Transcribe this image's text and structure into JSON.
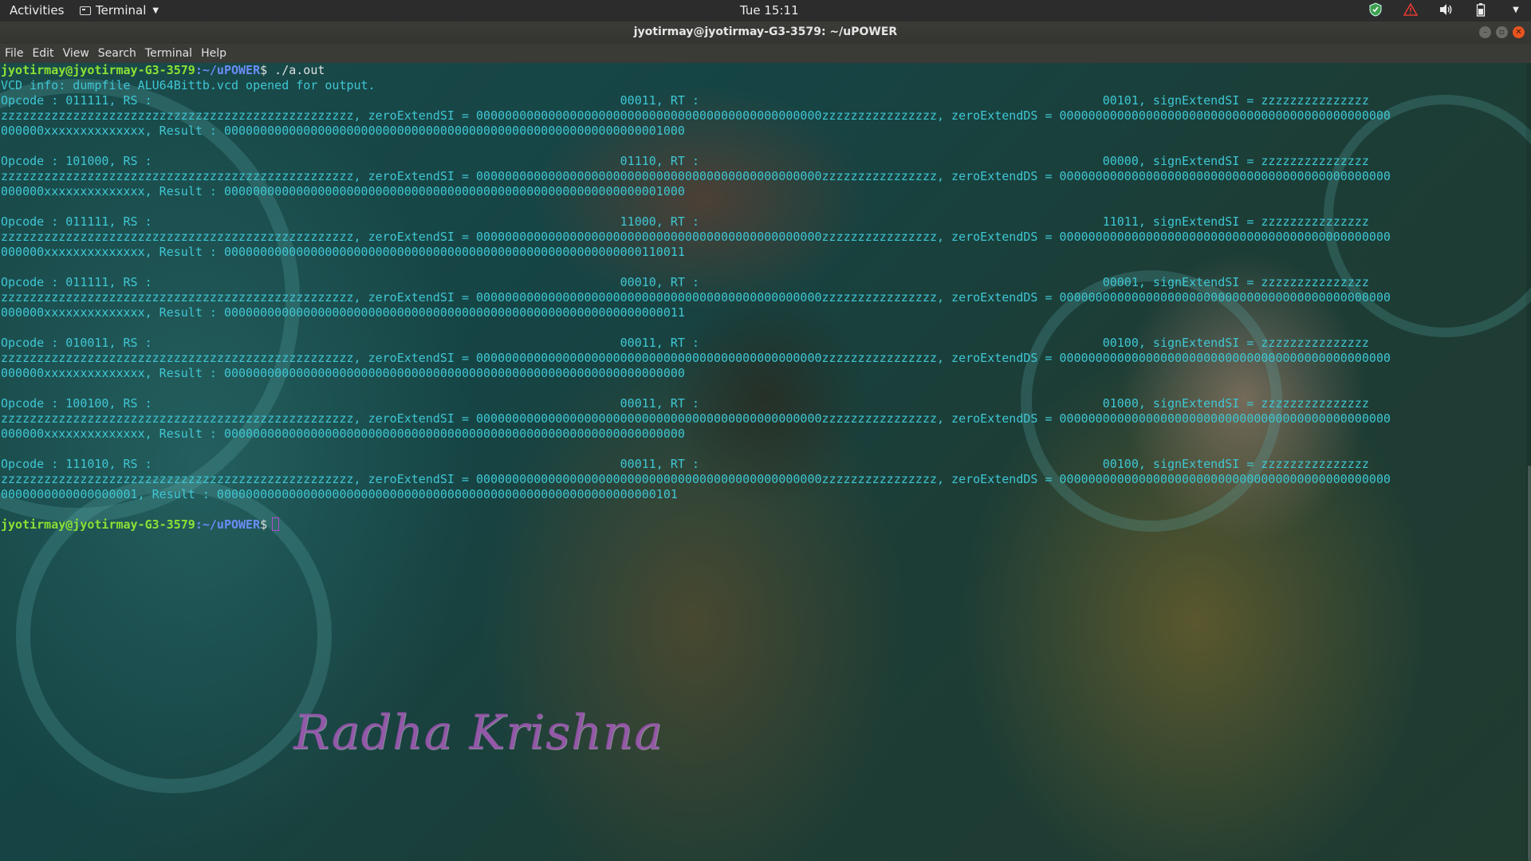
{
  "topbar": {
    "activities": "Activities",
    "app_name": "Terminal",
    "clock": "Tue 15:11",
    "tray_icons": [
      "shield-icon",
      "warning-icon",
      "volume-icon",
      "battery-icon",
      "chevron-down-icon"
    ]
  },
  "window": {
    "title": "jyotirmay@jyotirmay-G3-3579: ~/uPOWER"
  },
  "menu": {
    "items": [
      "File",
      "Edit",
      "View",
      "Search",
      "Terminal",
      "Help"
    ]
  },
  "terminal": {
    "prompt_user": "jyotirmay@jyotirmay-G3-3579",
    "prompt_path": ":~/uPOWER",
    "prompt_dollar": "$",
    "command": " ./a.out",
    "lines": [
      "VCD info: dumpfile ALU64Bittb.vcd opened for output.",
      "Opcode : 011111, RS :                                                                 00011, RT :                                                        00101, signExtendSI = zzzzzzzzzzzzzzz",
      "zzzzzzzzzzzzzzzzzzzzzzzzzzzzzzzzzzzzzzzzzzzzzzzzz, zeroExtendSI = 000000000000000000000000000000000000000000000000zzzzzzzzzzzzzzzz, zeroExtendDS = 0000000000000000000000000000000000000000000000",
      "000000xxxxxxxxxxxxxx, Result : 0000000000000000000000000000000000000000000000000000000000001000",
      "",
      "Opcode : 101000, RS :                                                                 01110, RT :                                                        00000, signExtendSI = zzzzzzzzzzzzzzz",
      "zzzzzzzzzzzzzzzzzzzzzzzzzzzzzzzzzzzzzzzzzzzzzzzzz, zeroExtendSI = 000000000000000000000000000000000000000000000000zzzzzzzzzzzzzzzz, zeroExtendDS = 0000000000000000000000000000000000000000000000",
      "000000xxxxxxxxxxxxxx, Result : 0000000000000000000000000000000000000000000000000000000000001000",
      "",
      "Opcode : 011111, RS :                                                                 11000, RT :                                                        11011, signExtendSI = zzzzzzzzzzzzzzz",
      "zzzzzzzzzzzzzzzzzzzzzzzzzzzzzzzzzzzzzzzzzzzzzzzzz, zeroExtendSI = 000000000000000000000000000000000000000000000000zzzzzzzzzzzzzzzz, zeroExtendDS = 0000000000000000000000000000000000000000000000",
      "000000xxxxxxxxxxxxxx, Result : 0000000000000000000000000000000000000000000000000000000000110011",
      "",
      "Opcode : 011111, RS :                                                                 00010, RT :                                                        00001, signExtendSI = zzzzzzzzzzzzzzz",
      "zzzzzzzzzzzzzzzzzzzzzzzzzzzzzzzzzzzzzzzzzzzzzzzzz, zeroExtendSI = 000000000000000000000000000000000000000000000000zzzzzzzzzzzzzzzz, zeroExtendDS = 0000000000000000000000000000000000000000000000",
      "000000xxxxxxxxxxxxxx, Result : 0000000000000000000000000000000000000000000000000000000000000011",
      "",
      "Opcode : 010011, RS :                                                                 00011, RT :                                                        00100, signExtendSI = zzzzzzzzzzzzzzz",
      "zzzzzzzzzzzzzzzzzzzzzzzzzzzzzzzzzzzzzzzzzzzzzzzzz, zeroExtendSI = 000000000000000000000000000000000000000000000000zzzzzzzzzzzzzzzz, zeroExtendDS = 0000000000000000000000000000000000000000000000",
      "000000xxxxxxxxxxxxxx, Result : 0000000000000000000000000000000000000000000000000000000000000000",
      "",
      "Opcode : 100100, RS :                                                                 00011, RT :                                                        01000, signExtendSI = zzzzzzzzzzzzzzz",
      "zzzzzzzzzzzzzzzzzzzzzzzzzzzzzzzzzzzzzzzzzzzzzzzzz, zeroExtendSI = 000000000000000000000000000000000000000000000000zzzzzzzzzzzzzzzz, zeroExtendDS = 0000000000000000000000000000000000000000000000",
      "000000xxxxxxxxxxxxxx, Result : 0000000000000000000000000000000000000000000000000000000000000000",
      "",
      "Opcode : 111010, RS :                                                                 00011, RT :                                                        00100, signExtendSI = zzzzzzzzzzzzzzz",
      "zzzzzzzzzzzzzzzzzzzzzzzzzzzzzzzzzzzzzzzzzzzzzzzzz, zeroExtendSI = 000000000000000000000000000000000000000000000000zzzzzzzzzzzzzzzz, zeroExtendDS = 0000000000000000000000000000000000000000000000",
      "0000000000000000001, Result : 0000000000000000000000000000000000000000000000000000000000000101",
      ""
    ]
  },
  "wallpaper": {
    "watermark": "Radha Krishna"
  },
  "colors": {
    "output_text": "#3fc7d4",
    "prompt_user": "#8ae234",
    "prompt_path": "#6b8cf7",
    "cursor": "#b04cd0"
  }
}
